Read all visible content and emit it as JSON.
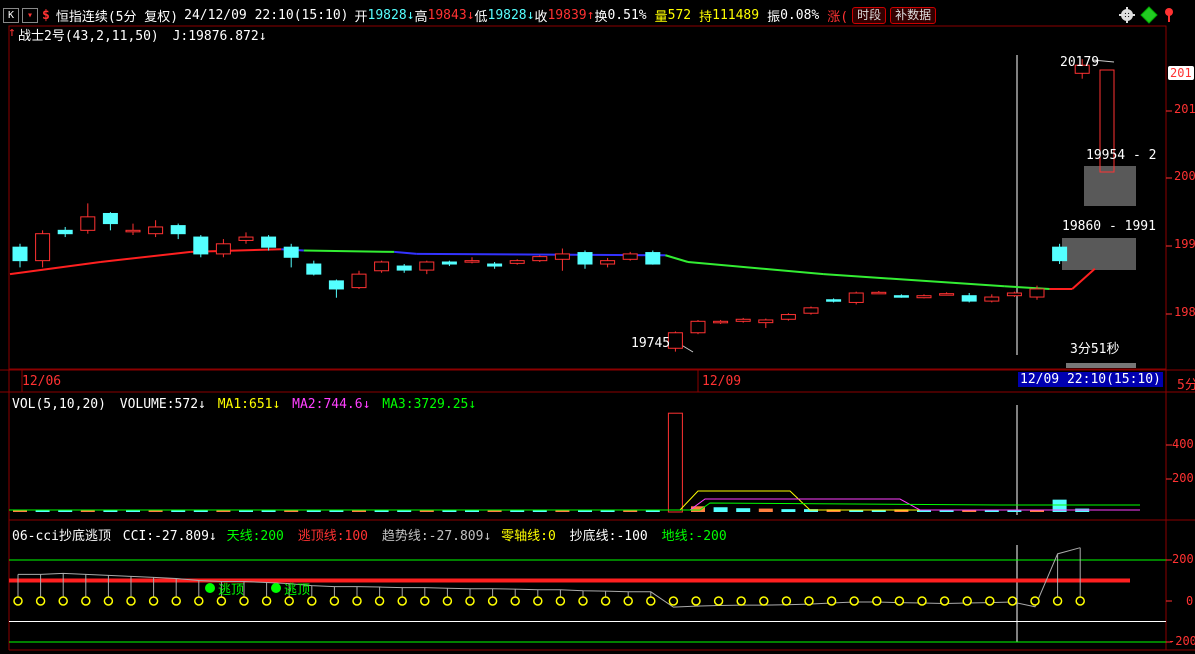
{
  "header": {
    "k_label": "K",
    "dropdown_glyph": "▾",
    "dollar_glyph": "$",
    "title": "恒指连续(5分 复权)",
    "datetime": "24/12/09 22:10(15:10)",
    "open_label": "开",
    "open_value": "19828",
    "high_label": "高",
    "high_value": "19843",
    "low_label": "低",
    "low_value": "19828",
    "close_label": "收",
    "close_value": "19839",
    "turnover_label": "换",
    "turnover_value": "0.51%",
    "volume_label": "量",
    "volume_value": "572",
    "hold_label": "持",
    "hold_value": "111489",
    "amplitude_label": "振",
    "amplitude_value": "0.08%",
    "change_label": "涨(",
    "btn_period": "时段",
    "btn_data": "补数据",
    "arrow_down": "↓",
    "arrow_up": "↑"
  },
  "indicator_line": {
    "name": "战士2号(43,2,11,50)",
    "j_label": "J:",
    "j_value": "19876.872"
  },
  "price_axis_labels": [
    "201",
    "201",
    "200",
    "199",
    "198"
  ],
  "price_tag": "201",
  "annotations": {
    "high_price": "20179",
    "low_price": "19745",
    "box1_label": "19954 - 2",
    "box2_label": "19860 - 1991",
    "countdown": "3分51秒"
  },
  "time_axis": {
    "left_date": "12/06",
    "mid_date": "12/09",
    "cursor": "12/09 22:10(15:10)",
    "end_fragment": "5分"
  },
  "volume_panel": {
    "title": "VOL(5,10,20)",
    "volume_label": "VOLUME:",
    "volume_value": "572",
    "ma1_label": "MA1:",
    "ma1_value": "651",
    "ma2_label": "MA2:",
    "ma2_value": "744.6",
    "ma3_label": "MA3:",
    "ma3_value": "3729.25",
    "axis_labels": [
      "400",
      "200"
    ]
  },
  "cci_panel": {
    "title": "06-cci抄底逃顶",
    "cci_label": "CCI:",
    "cci_value": "-27.809",
    "sky_label": "天线:",
    "sky_value": "200",
    "top_label": "逃顶线:",
    "top_value": "100",
    "trend_label": "趋势线:",
    "trend_value": "-27.809",
    "zero_label": "零轴线:",
    "zero_value": "0",
    "bottom_label": "抄底线:",
    "bottom_value": "-100",
    "ground_label": "地线:",
    "ground_value": "-200",
    "signal1": "逃顶",
    "signal2": "逃顶",
    "axis_labels": [
      "200",
      "0",
      "-200"
    ]
  },
  "colors": {
    "up": "#ff3232",
    "down": "#54ffff",
    "ma_red": "#ff2020",
    "ma_green": "#33ee33",
    "ma_blue": "#3333ff",
    "grid": "#8b0000",
    "yellow": "#ffff00",
    "magenta": "#ff40ff",
    "green": "#00ff00"
  },
  "candles": [
    {
      "o": 19900,
      "c": 19880,
      "h": 19905,
      "l": 19870
    },
    {
      "o": 19880,
      "c": 19920,
      "h": 19925,
      "l": 19870
    },
    {
      "o": 19925,
      "c": 19920,
      "h": 19930,
      "l": 19915
    },
    {
      "o": 19925,
      "c": 19945,
      "h": 19965,
      "l": 19920
    },
    {
      "o": 19950,
      "c": 19935,
      "h": 19952,
      "l": 19925
    },
    {
      "o": 19925,
      "c": 19925,
      "h": 19935,
      "l": 19918
    },
    {
      "o": 19920,
      "c": 19930,
      "h": 19940,
      "l": 19915
    },
    {
      "o": 19932,
      "c": 19920,
      "h": 19935,
      "l": 19912
    },
    {
      "o": 19915,
      "c": 19890,
      "h": 19918,
      "l": 19885
    },
    {
      "o": 19890,
      "c": 19905,
      "h": 19912,
      "l": 19885
    },
    {
      "o": 19910,
      "c": 19915,
      "h": 19922,
      "l": 19905
    },
    {
      "o": 19915,
      "c": 19900,
      "h": 19918,
      "l": 19895
    },
    {
      "o": 19900,
      "c": 19885,
      "h": 19905,
      "l": 19870
    },
    {
      "o": 19875,
      "c": 19860,
      "h": 19880,
      "l": 19858
    },
    {
      "o": 19850,
      "c": 19838,
      "h": 19852,
      "l": 19825
    },
    {
      "o": 19840,
      "c": 19860,
      "h": 19865,
      "l": 19838
    },
    {
      "o": 19865,
      "c": 19878,
      "h": 19880,
      "l": 19862
    },
    {
      "o": 19872,
      "c": 19866,
      "h": 19875,
      "l": 19862
    },
    {
      "o": 19866,
      "c": 19878,
      "h": 19880,
      "l": 19860
    },
    {
      "o": 19878,
      "c": 19875,
      "h": 19880,
      "l": 19872
    },
    {
      "o": 19879,
      "c": 19880,
      "h": 19885,
      "l": 19876
    },
    {
      "o": 19875,
      "c": 19872,
      "h": 19878,
      "l": 19868
    },
    {
      "o": 19876,
      "c": 19880,
      "h": 19882,
      "l": 19874
    },
    {
      "o": 19880,
      "c": 19886,
      "h": 19888,
      "l": 19878
    },
    {
      "o": 19882,
      "c": 19890,
      "h": 19898,
      "l": 19865
    },
    {
      "o": 19892,
      "c": 19875,
      "h": 19895,
      "l": 19868
    },
    {
      "o": 19875,
      "c": 19880,
      "h": 19884,
      "l": 19870
    },
    {
      "o": 19882,
      "c": 19890,
      "h": 19893,
      "l": 19880
    },
    {
      "o": 19892,
      "c": 19875,
      "h": 19895,
      "l": 19874
    },
    {
      "o": 19750,
      "c": 19773,
      "h": 19775,
      "l": 19745
    },
    {
      "o": 19773,
      "c": 19790,
      "h": 19792,
      "l": 19771
    },
    {
      "o": 19788,
      "c": 19790,
      "h": 19792,
      "l": 19786
    },
    {
      "o": 19790,
      "c": 19793,
      "h": 19795,
      "l": 19788
    },
    {
      "o": 19788,
      "c": 19792,
      "h": 19794,
      "l": 19780
    },
    {
      "o": 19793,
      "c": 19800,
      "h": 19802,
      "l": 19791
    },
    {
      "o": 19802,
      "c": 19810,
      "h": 19812,
      "l": 19800
    },
    {
      "o": 19822,
      "c": 19820,
      "h": 19824,
      "l": 19818
    },
    {
      "o": 19818,
      "c": 19832,
      "h": 19834,
      "l": 19815
    },
    {
      "o": 19832,
      "c": 19833,
      "h": 19835,
      "l": 19831
    },
    {
      "o": 19828,
      "c": 19826,
      "h": 19830,
      "l": 19825
    },
    {
      "o": 19825,
      "c": 19828,
      "h": 19830,
      "l": 19824
    },
    {
      "o": 19830,
      "c": 19831,
      "h": 19833,
      "l": 19829
    },
    {
      "o": 19828,
      "c": 19820,
      "h": 19832,
      "l": 19818
    },
    {
      "o": 19820,
      "c": 19826,
      "h": 19830,
      "l": 19818
    },
    {
      "o": 19828,
      "c": 19832,
      "h": 19834,
      "l": 19826
    },
    {
      "o": 19826,
      "c": 19838,
      "h": 19843,
      "l": 19822
    },
    {
      "o": 19900,
      "c": 19880,
      "h": 19905,
      "l": 19875
    },
    {
      "o": 20158,
      "c": 20170,
      "h": 20179,
      "l": 20150
    }
  ],
  "ma_line": [
    {
      "i": 0,
      "v": 19860,
      "c": "red"
    },
    {
      "i": 4,
      "v": 19878,
      "c": "red"
    },
    {
      "i": 8,
      "v": 19893,
      "c": "red"
    },
    {
      "i": 12,
      "v": 19897,
      "c": "red"
    },
    {
      "i": 13,
      "v": 19895,
      "c": "blue"
    },
    {
      "i": 17,
      "v": 19893,
      "c": "green"
    },
    {
      "i": 18,
      "v": 19890,
      "c": "blue"
    },
    {
      "i": 29,
      "v": 19888,
      "c": "blue"
    },
    {
      "i": 30,
      "v": 19878,
      "c": "green"
    },
    {
      "i": 36,
      "v": 19860,
      "c": "green"
    },
    {
      "i": 44,
      "v": 19842,
      "c": "green"
    },
    {
      "i": 46,
      "v": 19838,
      "c": "green"
    },
    {
      "i": 47,
      "v": 19838,
      "c": "red"
    },
    {
      "i": 48,
      "v": 19868,
      "c": "red"
    }
  ],
  "cci_values": [
    130,
    130,
    135,
    130,
    125,
    120,
    115,
    110,
    100,
    95,
    95,
    90,
    85,
    75,
    70,
    70,
    68,
    65,
    65,
    62,
    60,
    60,
    58,
    55,
    55,
    50,
    48,
    45,
    45,
    -30,
    -25,
    -22,
    -20,
    -20,
    -18,
    -15,
    -10,
    -5,
    -5,
    -8,
    -10,
    -12,
    -10,
    -8,
    -5,
    -28,
    230,
    260
  ],
  "volumes": [
    8,
    8,
    7,
    7,
    6,
    6,
    7,
    6,
    8,
    7,
    6,
    7,
    8,
    7,
    6,
    6,
    7,
    6,
    7,
    6,
    6,
    7,
    6,
    6,
    8,
    7,
    6,
    6,
    7,
    520,
    30,
    25,
    20,
    18,
    15,
    15,
    14,
    12,
    12,
    14,
    12,
    11,
    12,
    10,
    10,
    12,
    65,
    18
  ]
}
